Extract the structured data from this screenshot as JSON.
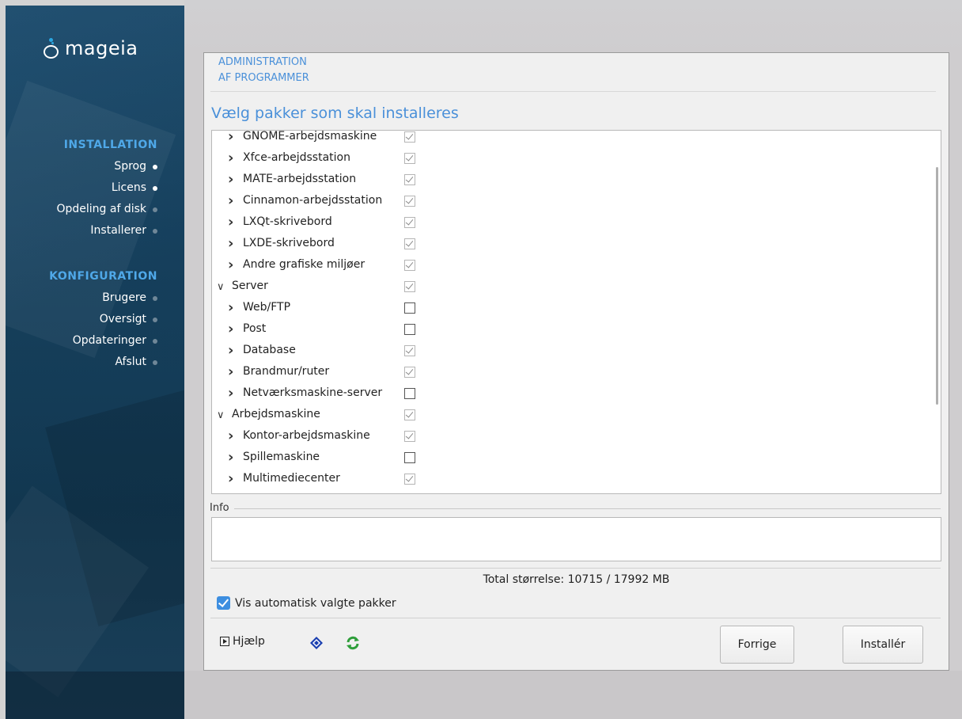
{
  "brand": {
    "logo_text": "mageia"
  },
  "sidebar": {
    "sections": [
      {
        "title": "INSTALLATION",
        "items": [
          {
            "label": "Sprog",
            "state": "done"
          },
          {
            "label": "Licens",
            "state": "done"
          },
          {
            "label": "Opdeling af disk",
            "state": "pending"
          },
          {
            "label": "Installerer",
            "state": "pending"
          }
        ]
      },
      {
        "title": "KONFIGURATION",
        "items": [
          {
            "label": "Brugere",
            "state": "pending"
          },
          {
            "label": "Oversigt",
            "state": "pending"
          },
          {
            "label": "Opdateringer",
            "state": "pending"
          },
          {
            "label": "Afslut",
            "state": "pending"
          }
        ]
      }
    ]
  },
  "dialog": {
    "header_line1": "ADMINISTRATION",
    "header_line2": "AF PROGRAMMER",
    "title": "Vælg pakker som skal installeres",
    "tree": [
      {
        "label": "GNOME-arbejdsmaskine",
        "level": 1,
        "expanded": false,
        "checked": true
      },
      {
        "label": "Xfce-arbejdsstation",
        "level": 1,
        "expanded": false,
        "checked": true
      },
      {
        "label": "MATE-arbejdsstation",
        "level": 1,
        "expanded": false,
        "checked": true
      },
      {
        "label": "Cinnamon-arbejdsstation",
        "level": 1,
        "expanded": false,
        "checked": true
      },
      {
        "label": "LXQt-skrivebord",
        "level": 1,
        "expanded": false,
        "checked": true
      },
      {
        "label": "LXDE-skrivebord",
        "level": 1,
        "expanded": false,
        "checked": true
      },
      {
        "label": "Andre grafiske miljøer",
        "level": 1,
        "expanded": false,
        "checked": true
      },
      {
        "label": "Server",
        "level": 0,
        "expanded": true,
        "checked": true
      },
      {
        "label": "Web/FTP",
        "level": 1,
        "expanded": false,
        "checked": false
      },
      {
        "label": "Post",
        "level": 1,
        "expanded": false,
        "checked": false
      },
      {
        "label": "Database",
        "level": 1,
        "expanded": false,
        "checked": true
      },
      {
        "label": "Brandmur/ruter",
        "level": 1,
        "expanded": false,
        "checked": true
      },
      {
        "label": "Netværksmaskine-server",
        "level": 1,
        "expanded": false,
        "checked": false
      },
      {
        "label": "Arbejdsmaskine",
        "level": 0,
        "expanded": true,
        "checked": true
      },
      {
        "label": "Kontor-arbejdsmaskine",
        "level": 1,
        "expanded": false,
        "checked": true
      },
      {
        "label": "Spillemaskine",
        "level": 1,
        "expanded": false,
        "checked": false
      },
      {
        "label": "Multimediecenter",
        "level": 1,
        "expanded": false,
        "checked": true
      }
    ],
    "info_label": "Info",
    "info_text": "",
    "total_size": "Total størrelse: 10715 / 17992 MB",
    "auto_select_label": "Vis automatisk valgte pakker",
    "auto_select_checked": true,
    "help_label": "Hjælp",
    "prev_label": "Forrige",
    "install_label": "Installér"
  },
  "colors": {
    "accent": "#4a90d9",
    "sidebar_section": "#4fa8e8",
    "checkbox_blue": "#3d8ee0",
    "refresh_green": "#2e9e3a",
    "floppy_blue": "#1a3fb0"
  }
}
